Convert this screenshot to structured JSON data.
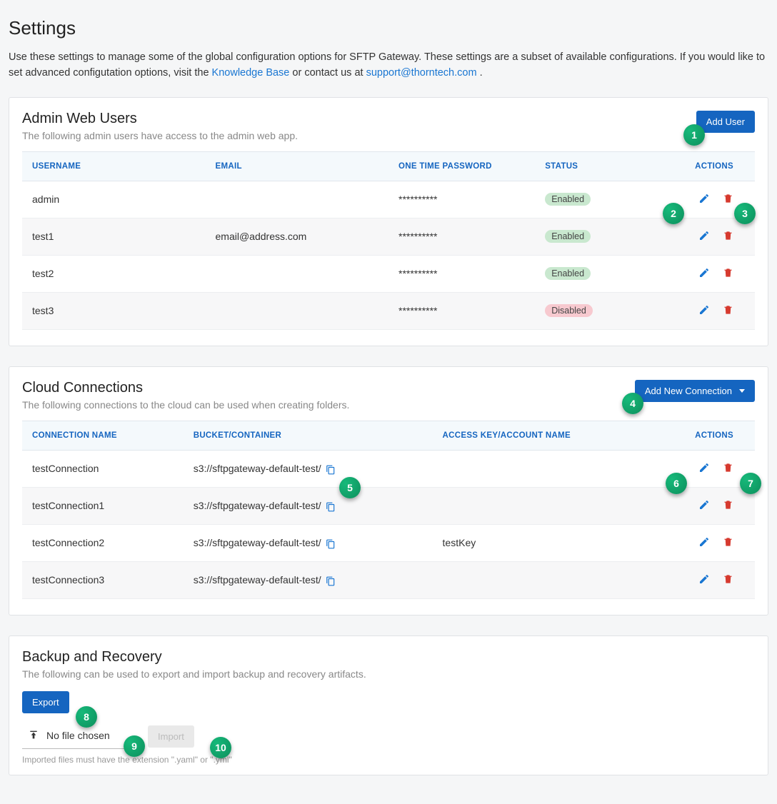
{
  "page": {
    "title": "Settings",
    "intro_pre": "Use these settings to manage some of the global configuration options for SFTP Gateway. These settings are a subset of available configurations. If you would like to set advanced configutation options, visit the ",
    "kb_link": "Knowledge Base",
    "intro_mid": " or contact us at ",
    "support_link": "support@thorntech.com",
    "intro_end": "."
  },
  "admin": {
    "title": "Admin Web Users",
    "subtitle": "The following admin users have access to the admin web app.",
    "add_user": "Add User",
    "headers": {
      "username": "USERNAME",
      "email": "EMAIL",
      "otp": "ONE TIME PASSWORD",
      "status": "STATUS",
      "actions": "ACTIONS"
    },
    "rows": [
      {
        "username": "admin",
        "email": "",
        "otp": "**********",
        "status": "Enabled",
        "status_class": "enabled"
      },
      {
        "username": "test1",
        "email": "email@address.com",
        "otp": "**********",
        "status": "Enabled",
        "status_class": "enabled"
      },
      {
        "username": "test2",
        "email": "",
        "otp": "**********",
        "status": "Enabled",
        "status_class": "enabled"
      },
      {
        "username": "test3",
        "email": "",
        "otp": "**********",
        "status": "Disabled",
        "status_class": "disabled"
      }
    ]
  },
  "cloud": {
    "title": "Cloud Connections",
    "subtitle": "The following connections to the cloud can be used when creating folders.",
    "add_conn": "Add New Connection",
    "headers": {
      "name": "CONNECTION NAME",
      "bucket": "BUCKET/CONTAINER",
      "key": "ACCESS KEY/ACCOUNT NAME",
      "actions": "ACTIONS"
    },
    "rows": [
      {
        "name": "testConnection",
        "bucket": "s3://sftpgateway-default-test/",
        "key": ""
      },
      {
        "name": "testConnection1",
        "bucket": "s3://sftpgateway-default-test/",
        "key": ""
      },
      {
        "name": "testConnection2",
        "bucket": "s3://sftpgateway-default-test/",
        "key": "testKey"
      },
      {
        "name": "testConnection3",
        "bucket": "s3://sftpgateway-default-test/",
        "key": ""
      }
    ]
  },
  "backup": {
    "title": "Backup and Recovery",
    "subtitle": "The following can be used to export and import backup and recovery artifacts.",
    "export": "Export",
    "no_file": "No file chosen",
    "import": "Import",
    "hint": "Imported files must have the extension \".yaml\" or \".yml\""
  },
  "markers": [
    "1",
    "2",
    "3",
    "4",
    "5",
    "6",
    "7",
    "8",
    "9",
    "10"
  ]
}
